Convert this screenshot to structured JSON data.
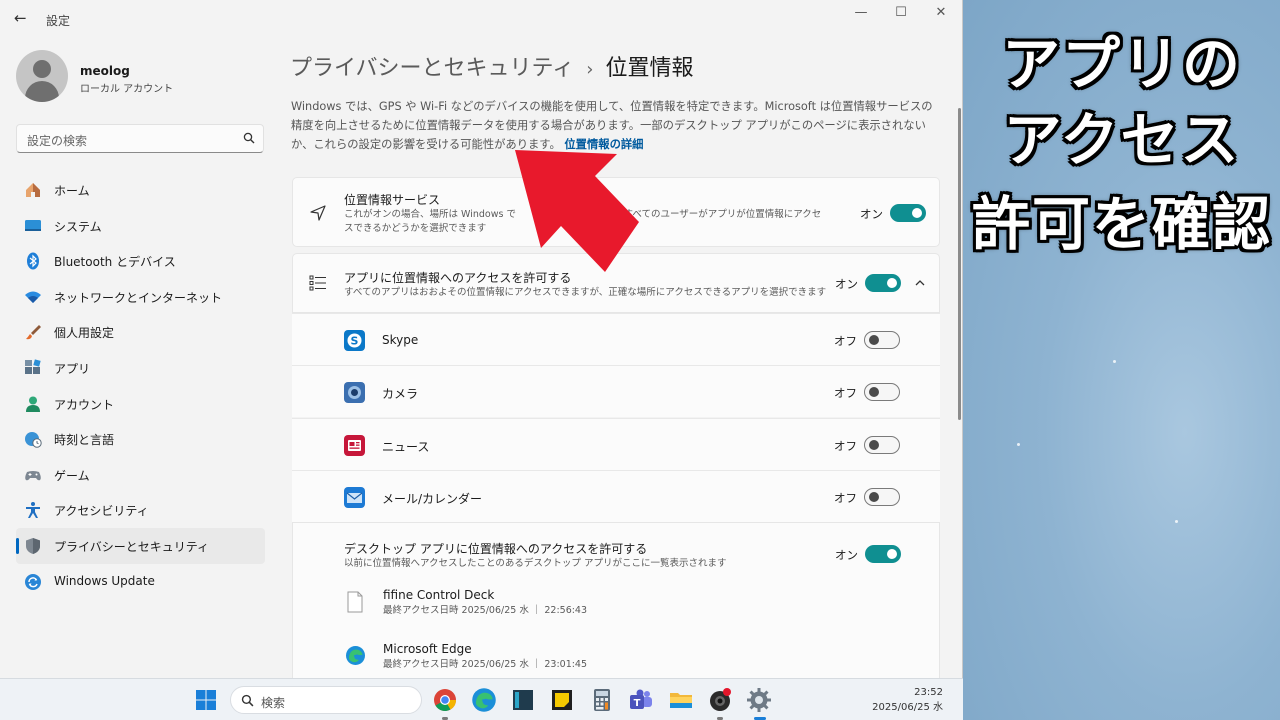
{
  "window": {
    "title": "設定"
  },
  "window_controls": {
    "minimize": "—",
    "maximize": "☐",
    "close": "✕"
  },
  "user": {
    "name": "meolog",
    "account_type": "ローカル アカウント"
  },
  "search": {
    "placeholder": "設定の検索"
  },
  "sidebar": {
    "items": [
      {
        "label": "ホーム",
        "icon": "home-icon"
      },
      {
        "label": "システム",
        "icon": "system-icon"
      },
      {
        "label": "Bluetooth とデバイス",
        "icon": "bluetooth-icon"
      },
      {
        "label": "ネットワークとインターネット",
        "icon": "wifi-icon"
      },
      {
        "label": "個人用設定",
        "icon": "brush-icon"
      },
      {
        "label": "アプリ",
        "icon": "apps-icon"
      },
      {
        "label": "アカウント",
        "icon": "account-icon"
      },
      {
        "label": "時刻と言語",
        "icon": "globe-clock-icon"
      },
      {
        "label": "ゲーム",
        "icon": "gamepad-icon"
      },
      {
        "label": "アクセシビリティ",
        "icon": "accessibility-icon"
      },
      {
        "label": "プライバシーとセキュリティ",
        "icon": "shield-icon",
        "selected": true
      },
      {
        "label": "Windows Update",
        "icon": "update-icon"
      }
    ]
  },
  "breadcrumb": {
    "parent": "プライバシーとセキュリティ",
    "separator": "›",
    "current": "位置情報"
  },
  "description": {
    "text": "Windows では、GPS や Wi-Fi などのデバイスの機能を使用して、位置情報を特定できます。Microsoft は位置情報サービスの精度を向上させるために位置情報データを使用する場合があります。一部のデスクトップ アプリがこのページに表示されないか、これらの設定の影響を受ける可能性があります。",
    "link": "位置情報の詳細"
  },
  "location_service": {
    "title": "位置情報サービス",
    "subtitle_a": "これがオンの場合、場所は Windows で",
    "subtitle_b": "用するすべてのユーザーがアプリが位置情報にアクセ",
    "subtitle_c": "スできるかどうかを選択できます",
    "state": "オン",
    "enabled": true
  },
  "app_access": {
    "title": "アプリに位置情報へのアクセスを許可する",
    "subtitle": "すべてのアプリはおおよその位置情報にアクセスできますが、正確な場所にアクセスできるアプリを選択できます",
    "state": "オン",
    "enabled": true
  },
  "apps": [
    {
      "name": "Skype",
      "state": "オフ",
      "enabled": false,
      "color": "#0b78c8"
    },
    {
      "name": "カメラ",
      "state": "オフ",
      "enabled": false,
      "color": "#3b6fb0"
    },
    {
      "name": "ニュース",
      "state": "オフ",
      "enabled": false,
      "color": "#c6173a"
    },
    {
      "name": "メール/カレンダー",
      "state": "オフ",
      "enabled": false,
      "color": "#1d7ad4"
    }
  ],
  "desktop_access": {
    "title": "デスクトップ アプリに位置情報へのアクセスを許可する",
    "subtitle": "以前に位置情報へアクセスしたことのあるデスクトップ アプリがここに一覧表示されます",
    "state": "オン",
    "enabled": true
  },
  "desktop_apps": [
    {
      "name": "fifine Control Deck",
      "last_access": "最終アクセス日時 2025/06/25 水 ｜ 22:56:43"
    },
    {
      "name": "Microsoft Edge",
      "last_access": "最終アクセス日時 2025/06/25 水 ｜ 23:01:45"
    }
  ],
  "taskbar": {
    "search_placeholder": "検索",
    "time": "23:52",
    "date": "2025/06/25 水"
  },
  "caption": {
    "line1": "アプリの",
    "line2": "アクセス",
    "line3": "許可を確認"
  },
  "colors": {
    "accent": "#0f8f91",
    "arrow": "#e8192c",
    "link": "#005a9e"
  }
}
